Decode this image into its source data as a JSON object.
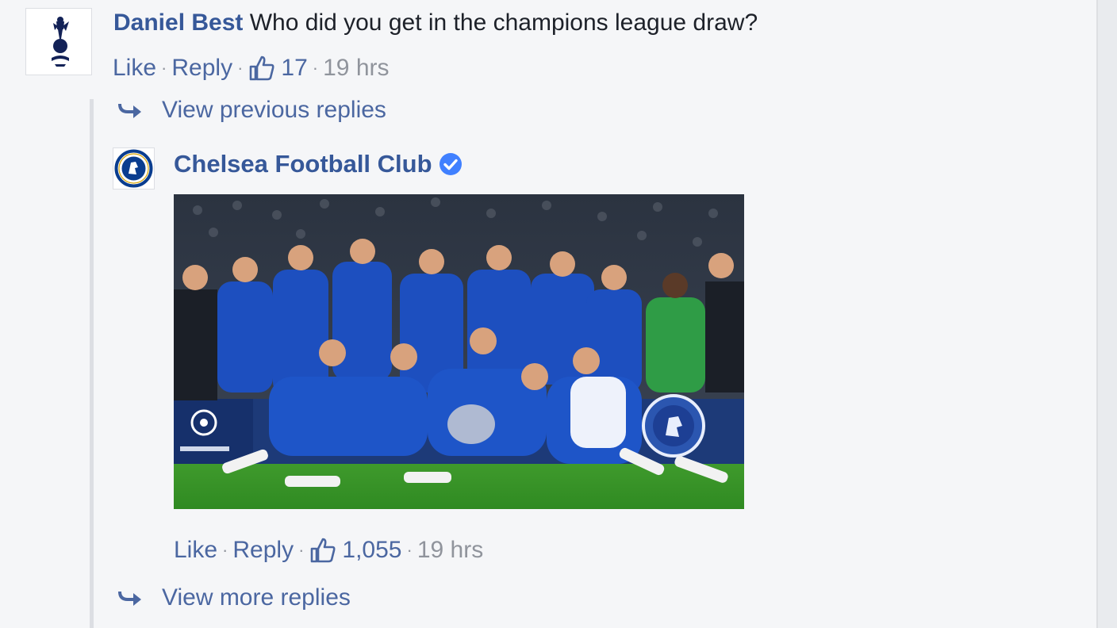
{
  "comment": {
    "author": "Daniel Best",
    "text": "Who did you get in the champions league draw?",
    "actions": {
      "like": "Like",
      "reply": "Reply",
      "sep": "·",
      "likes": "17",
      "time": "19 hrs"
    }
  },
  "view_previous": "View previous replies",
  "reply": {
    "author": "Chelsea Football Club",
    "verified": true,
    "image_icon": "team-celebration-photo",
    "actions": {
      "like": "Like",
      "reply": "Reply",
      "sep": "·",
      "likes": "1,055",
      "time": "19 hrs"
    }
  },
  "view_more": "View more replies",
  "colors": {
    "link": "#365899",
    "action": "#4b67a1",
    "muted": "#90949c",
    "background": "#f5f6f8",
    "verified": "#4080ff"
  }
}
